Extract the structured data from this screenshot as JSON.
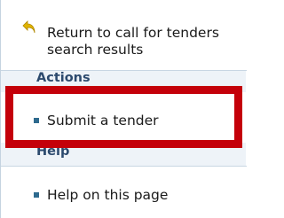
{
  "return_link": {
    "label": "Return to call for tenders search results",
    "icon": "return-arrow-icon"
  },
  "sections": {
    "actions": {
      "title": "Actions",
      "items": [
        {
          "label": "Submit a tender"
        }
      ]
    },
    "help": {
      "title": "Help",
      "items": [
        {
          "label": "Help on this page"
        }
      ]
    }
  },
  "highlight": {
    "color": "#c4000a",
    "target": "Submit a tender"
  },
  "colors": {
    "bullet": "#2e6a8e",
    "section_header": "#2c4a6e",
    "panel_bg": "#eef3f8",
    "arrow": "#e0b400"
  }
}
